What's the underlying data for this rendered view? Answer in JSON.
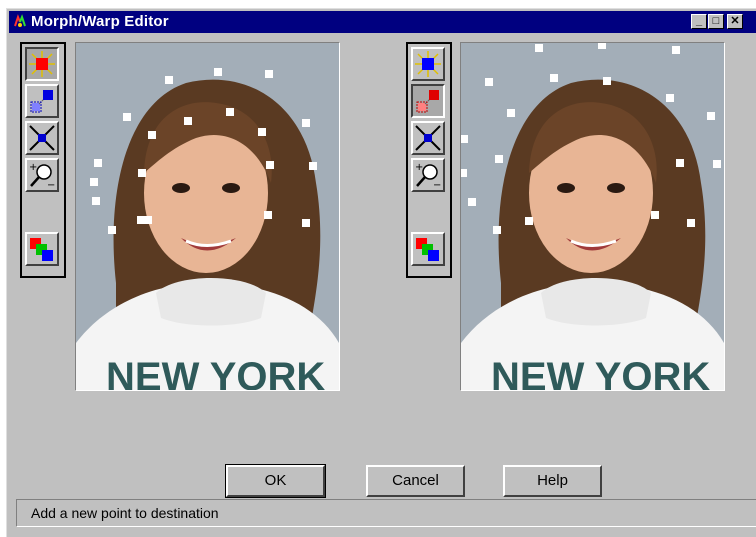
{
  "window": {
    "title": "Morph/Warp Editor",
    "controls": {
      "minimize": "_",
      "maximize": "□",
      "close": "✕"
    }
  },
  "left_toolbar": {
    "tools": [
      {
        "name": "add-point-tool",
        "icon": "sparkle-red-square-icon",
        "pressed": true
      },
      {
        "name": "move-point-tool",
        "icon": "move-squares-icon",
        "pressed": false
      },
      {
        "name": "delete-point-tool",
        "icon": "x-cross-icon",
        "pressed": false
      },
      {
        "name": "zoom-tool",
        "icon": "magnifier-plus-minus-icon",
        "pressed": false
      },
      {
        "name": "color-tool",
        "icon": "rgb-squares-icon",
        "pressed": false
      }
    ]
  },
  "right_toolbar": {
    "tools": [
      {
        "name": "add-point-tool",
        "icon": "sparkle-blue-square-icon",
        "pressed": false
      },
      {
        "name": "move-point-tool",
        "icon": "move-squares-icon",
        "pressed": true
      },
      {
        "name": "delete-point-tool",
        "icon": "x-cross-icon",
        "pressed": false
      },
      {
        "name": "zoom-tool",
        "icon": "magnifier-plus-minus-icon",
        "pressed": false
      },
      {
        "name": "color-tool",
        "icon": "rgb-squares-icon",
        "pressed": false
      }
    ]
  },
  "source_image": {
    "subject": "photo of a smiling girl in a white hoodie",
    "shirt_text": "NEW YORK"
  },
  "destination_image": {
    "subject": "photo of a smiling girl in a white hoodie",
    "shirt_text": "NEW YORK"
  },
  "buttons": {
    "ok": "OK",
    "cancel": "Cancel",
    "help": "Help"
  },
  "status_bar": {
    "message": "Add a new point to destination"
  },
  "colors": {
    "titlebar": "#000080",
    "face": "#c0c0c0",
    "point": "#ffffff"
  }
}
